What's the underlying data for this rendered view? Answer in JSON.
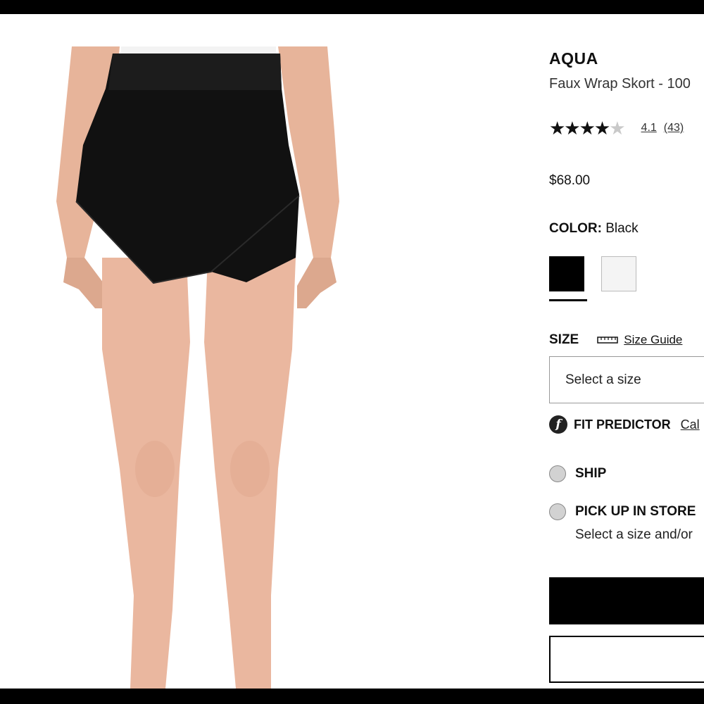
{
  "product": {
    "brand": "AQUA",
    "name": "Faux Wrap Skort - 100",
    "rating_value": "4.1",
    "review_count": "(43)",
    "stars_full": "★★★★",
    "stars_partial": "★",
    "price": "$68.00"
  },
  "color": {
    "label": "COLOR:",
    "selected": "Black",
    "swatches": [
      {
        "name": "Black",
        "hex": "#000000"
      },
      {
        "name": "White",
        "hex": "#f4f4f4"
      }
    ]
  },
  "size": {
    "label": "SIZE",
    "guide_link": "Size Guide",
    "select_placeholder": "Select a size"
  },
  "fit_predictor": {
    "icon_glyph": "f",
    "label": "FIT PREDICTOR",
    "link": "Cal"
  },
  "fulfillment": {
    "ship_label": "SHIP",
    "pickup_label": "PICK UP IN STORE",
    "pickup_note": "Select a size and/or"
  },
  "buttons": {
    "primary_label": "",
    "secondary_label": ""
  },
  "colors": {
    "accent": "#000000",
    "background": "#ffffff"
  }
}
